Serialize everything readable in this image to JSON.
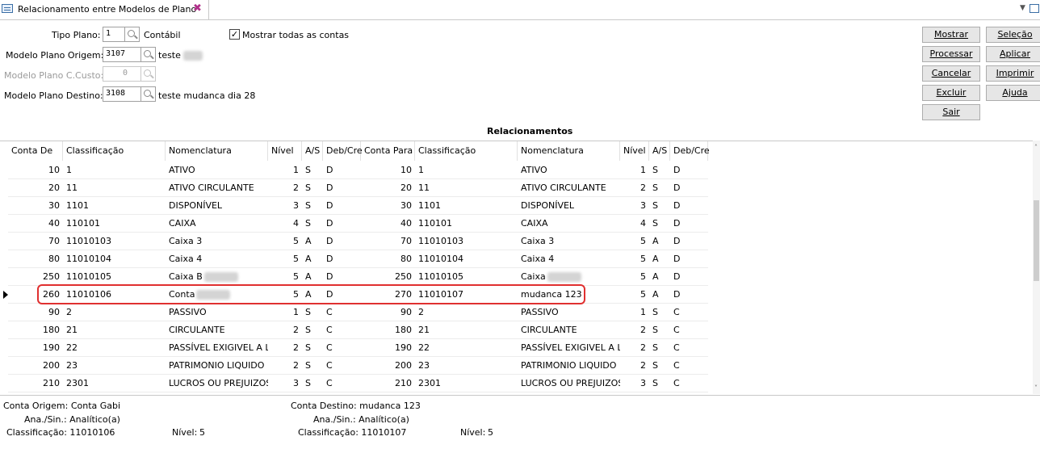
{
  "tab": {
    "title": "Relacionamento entre Modelos de Plano",
    "close_icon": "close-icon"
  },
  "form": {
    "tipo_plano_label": "Tipo Plano:",
    "tipo_plano_value": "1",
    "tipo_plano_desc": "Contábil",
    "mostrar_todas_label": "Mostrar todas as contas",
    "mostrar_todas_checked": "✓",
    "origem_label": "Modelo Plano Origem:",
    "origem_value": "3107",
    "origem_desc": "teste",
    "ccusto_label": "Modelo Plano C.Custo:",
    "ccusto_value": "0",
    "destino_label": "Modelo Plano Destino:",
    "destino_value": "3108",
    "destino_desc": "teste mudanca dia 28"
  },
  "buttons": {
    "mostrar": "Mostrar",
    "selecao": "Seleção",
    "processar": "Processar",
    "aplicar": "Aplicar",
    "cancelar": "Cancelar",
    "imprimir": "Imprimir",
    "excluir": "Excluir",
    "ajuda": "Ajuda",
    "sair": "Sair"
  },
  "section_title": "Relacionamentos",
  "columns": [
    "Conta De",
    "Classificação",
    "Nomenclatura",
    "Nível",
    "A/S",
    "Deb/Cre",
    "Conta Para",
    "Classificação",
    "Nomenclatura",
    "Nível",
    "A/S",
    "Deb/Cre"
  ],
  "rows": [
    [
      "10",
      "1",
      "ATIVO",
      "1",
      "S",
      "D",
      "10",
      "1",
      "ATIVO",
      "1",
      "S",
      "D"
    ],
    [
      "20",
      "11",
      "ATIVO CIRCULANTE",
      "2",
      "S",
      "D",
      "20",
      "11",
      "ATIVO CIRCULANTE",
      "2",
      "S",
      "D"
    ],
    [
      "30",
      "1101",
      "DISPONÍVEL",
      "3",
      "S",
      "D",
      "30",
      "1101",
      "DISPONÍVEL",
      "3",
      "S",
      "D"
    ],
    [
      "40",
      "110101",
      "CAIXA",
      "4",
      "S",
      "D",
      "40",
      "110101",
      "CAIXA",
      "4",
      "S",
      "D"
    ],
    [
      "70",
      "11010103",
      "Caixa 3",
      "5",
      "A",
      "D",
      "70",
      "11010103",
      "Caixa 3",
      "5",
      "A",
      "D"
    ],
    [
      "80",
      "11010104",
      "Caixa 4",
      "5",
      "A",
      "D",
      "80",
      "11010104",
      "Caixa 4",
      "5",
      "A",
      "D"
    ],
    [
      "250",
      "11010105",
      "Caixa B",
      "5",
      "A",
      "D",
      "250",
      "11010105",
      "Caixa",
      "5",
      "A",
      "D"
    ],
    [
      "260",
      "11010106",
      "Conta",
      "5",
      "A",
      "D",
      "270",
      "11010107",
      "mudanca 123",
      "5",
      "A",
      "D"
    ],
    [
      "90",
      "2",
      "PASSIVO",
      "1",
      "S",
      "C",
      "90",
      "2",
      "PASSIVO",
      "1",
      "S",
      "C"
    ],
    [
      "180",
      "21",
      "CIRCULANTE",
      "2",
      "S",
      "C",
      "180",
      "21",
      "CIRCULANTE",
      "2",
      "S",
      "C"
    ],
    [
      "190",
      "22",
      "PASSÍVEL EXIGIVEL A LOI",
      "2",
      "S",
      "C",
      "190",
      "22",
      "PASSÍVEL EXIGIVEL A LOI",
      "2",
      "S",
      "C"
    ],
    [
      "200",
      "23",
      "PATRIMONIO LIQUIDO",
      "2",
      "S",
      "C",
      "200",
      "23",
      "PATRIMONIO LIQUIDO",
      "2",
      "S",
      "C"
    ],
    [
      "210",
      "2301",
      "LUCROS OU PREJUIZOS",
      "3",
      "S",
      "C",
      "210",
      "2301",
      "LUCROS OU PREJUIZOS",
      "3",
      "S",
      "C"
    ]
  ],
  "footer": {
    "conta_origem": "Conta Origem: Conta Gabi",
    "ana_sin_origem": "Ana./Sin.: Analítico(a)",
    "classificacao_origem": "Classificação: 11010106",
    "nivel_origem_label": "Nível:",
    "nivel_origem": "5",
    "conta_destino": "Conta Destino: mudanca 123",
    "ana_sin_destino": "Ana./Sin.: Analítico(a)",
    "classificacao_destino": "Classificação: 11010107",
    "nivel_destino_label": "Nível:",
    "nivel_destino": "5"
  }
}
